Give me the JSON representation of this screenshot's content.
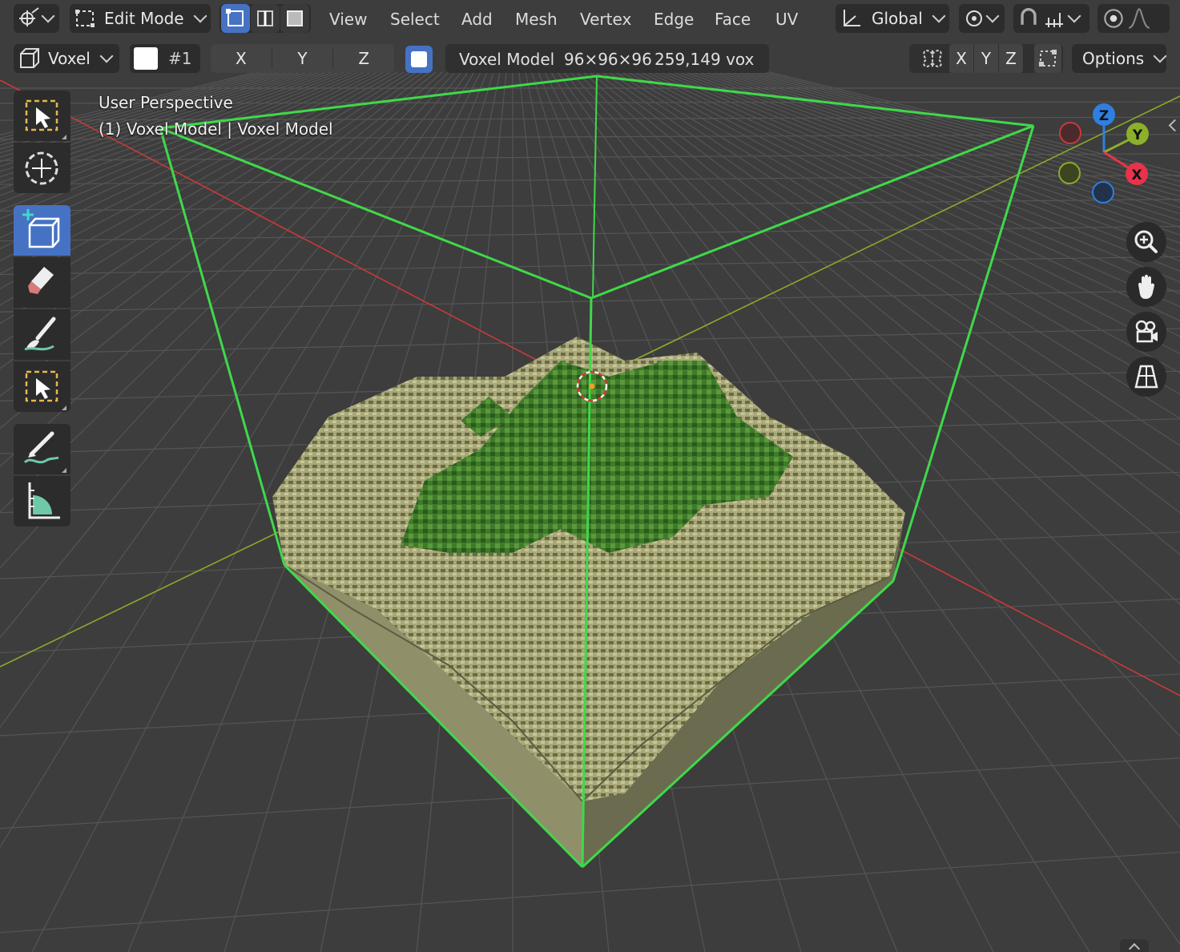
{
  "header": {
    "mode_label": "Edit Mode",
    "menus": [
      "View",
      "Select",
      "Add",
      "Mesh",
      "Vertex",
      "Edge",
      "Face",
      "UV"
    ],
    "transform_orientation": "Global"
  },
  "tool_header": {
    "brush_label": "Voxel",
    "color_index": "#1",
    "axis_buttons": [
      "X",
      "Y",
      "Z"
    ],
    "model_name": "Voxel Model",
    "dimensions": "96×96×96",
    "voxel_count": "259,149 vox",
    "mirror_axes": [
      "X",
      "Y",
      "Z"
    ],
    "options_label": "Options"
  },
  "viewport": {
    "view_name": "User Perspective",
    "object_info": "(1) Voxel Model | Voxel Model"
  },
  "gizmo": {
    "z_label": "Z",
    "y_label": "Y",
    "x_label": "X",
    "colors": {
      "x": "#e8334a",
      "y": "#8bb02a",
      "z": "#2f7fe0"
    }
  },
  "colors": {
    "accent": "#4672c4",
    "bounds": "#3fd94a",
    "terrain": "#b8b88a",
    "foliage": "#3f7a2a",
    "x_axis": "#c83a3a",
    "y_axis": "#8aab2a"
  }
}
